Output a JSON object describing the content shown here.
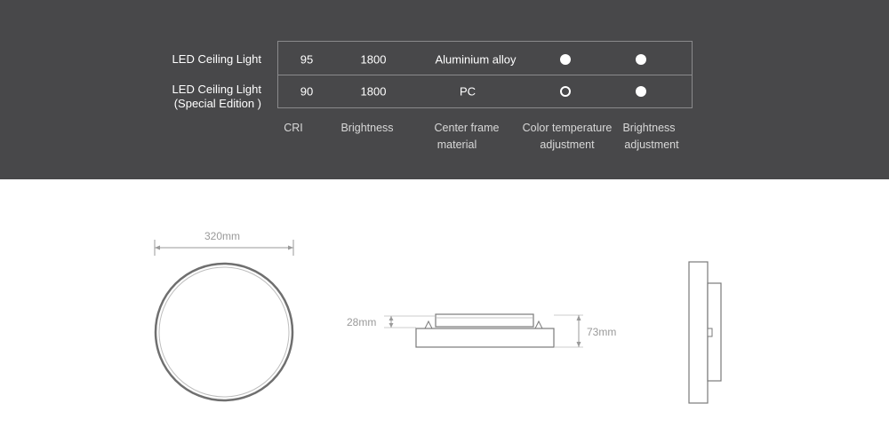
{
  "spec_table": {
    "rows": [
      {
        "label_lines": [
          "LED Ceiling Light"
        ],
        "cri": "95",
        "brightness": "1800",
        "center_frame_material": "Aluminium alloy",
        "color_temperature_adjustment": "filled-circle-icon",
        "brightness_adjustment": "filled-circle-icon"
      },
      {
        "label_lines": [
          "LED Ceiling Light",
          "(Special Edition )"
        ],
        "cri": "90",
        "brightness": "1800",
        "center_frame_material": "PC",
        "color_temperature_adjustment": "empty-circle-icon",
        "brightness_adjustment": "filled-circle-icon"
      }
    ],
    "columns": [
      {
        "lines": [
          "CRI"
        ]
      },
      {
        "lines": [
          "Brightness"
        ]
      },
      {
        "lines": [
          "Center frame",
          "material"
        ]
      },
      {
        "lines": [
          "Color temperature",
          "adjustment"
        ]
      },
      {
        "lines": [
          "Brightness",
          "adjustment"
        ]
      }
    ]
  },
  "dimensions": {
    "diameter": "320mm",
    "panel_thickness": "28mm",
    "total_height": "73mm"
  },
  "colors": {
    "panel_background": "#48484a",
    "page_background": "#ffffff",
    "drawing_line": "#7a7a7a"
  }
}
